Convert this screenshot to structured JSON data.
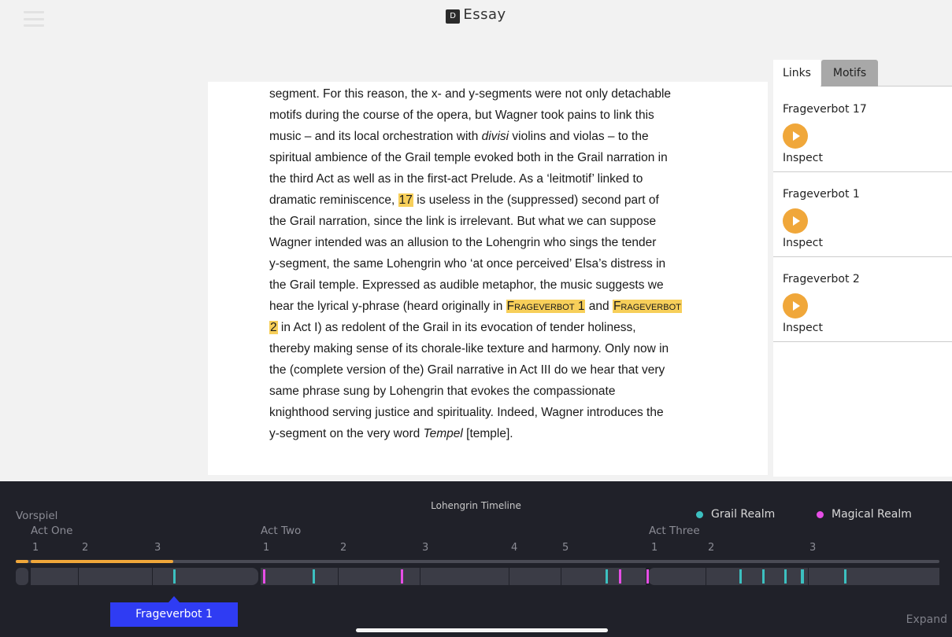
{
  "header": {
    "title": "Essay",
    "doc_icon": "document-icon"
  },
  "essay": {
    "lines": [
      [
        {
          "t": "segment. For this reason, the x- and y-segments were not only detachable"
        }
      ],
      [
        {
          "t": "motifs during the course of the opera, but Wagner took pains to link this"
        }
      ],
      [
        {
          "t": "music – and its local orchestration with "
        },
        {
          "t": "divisi",
          "s": "em"
        },
        {
          "t": " violins and violas – to the"
        }
      ],
      [
        {
          "t": "spiritual ambience of the Grail temple evoked both in the Grail narration in"
        }
      ],
      [
        {
          "t": "the third Act as well as in the first-act Prelude. As a ‘leitmotif’ linked to"
        }
      ],
      [
        {
          "t": "dramatic reminiscence, "
        },
        {
          "t": "17",
          "s": "hl"
        },
        {
          "t": " is useless in the (suppressed) second part of"
        }
      ],
      [
        {
          "t": "the Grail narration, since the link is irrelevant. But what we can suppose"
        }
      ],
      [
        {
          "t": "Wagner intended was an allusion to the Lohengrin who sings the tender"
        }
      ],
      [
        {
          "t": "y-segment, the same Lohengrin who ‘at once perceived’ Elsa’s distress in"
        }
      ],
      [
        {
          "t": "the Grail temple. Expressed as audible metaphor, the music suggests we"
        }
      ],
      [
        {
          "t": "hear the lyrical y-phrase (heard originally in "
        },
        {
          "t": "Frageverbot 1",
          "s": "hl sc"
        },
        {
          "t": " and "
        },
        {
          "t": "Frageverbot",
          "s": "hl sc"
        }
      ],
      [
        {
          "t": "2",
          "s": "hl"
        },
        {
          "t": " in Act I) as redolent of the Grail in its evocation of tender holiness,"
        }
      ],
      [
        {
          "t": "thereby making sense of its chorale-like texture and harmony. Only now in"
        }
      ],
      [
        {
          "t": "the (complete version of the) Grail narrative in Act III do we hear that very"
        }
      ],
      [
        {
          "t": "same phrase sung by Lohengrin that evokes the compassionate"
        }
      ],
      [
        {
          "t": "knighthood serving justice and spirituality. Indeed, Wagner introduces the"
        }
      ],
      [
        {
          "t": "y-segment on the very word "
        },
        {
          "t": "Tempel",
          "s": "em"
        },
        {
          "t": " [temple]."
        }
      ]
    ]
  },
  "sidebar": {
    "tabs": [
      {
        "label": "Links",
        "active": true
      },
      {
        "label": "Motifs",
        "active": false
      }
    ],
    "links": [
      {
        "title": "Frageverbot 17",
        "action": "Inspect",
        "icon": "play-icon"
      },
      {
        "title": "Frageverbot 1",
        "action": "Inspect",
        "icon": "play-icon"
      },
      {
        "title": "Frageverbot 2",
        "action": "Inspect",
        "icon": "play-icon"
      }
    ]
  },
  "timeline": {
    "title": "Lohengrin Timeline",
    "legend": [
      {
        "label": "Grail Realm",
        "color": "#3cc0c0"
      },
      {
        "label": "Magical Realm",
        "color": "#e64ee6"
      }
    ],
    "sections": {
      "prelude": "Vorspiel",
      "act1": "Act One",
      "act2": "Act Two",
      "act3": "Act Three"
    },
    "scenes": {
      "act1": [
        "1",
        "2",
        "3"
      ],
      "act2": [
        "1",
        "2",
        "3",
        "4",
        "5"
      ],
      "act3": [
        "1",
        "2",
        "3"
      ]
    },
    "tooltip": "Frageverbot 1",
    "expand_label": "Expand",
    "colors": {
      "progress": "#f0a73a",
      "grail": "#3cc0c0",
      "magical": "#e64ee6",
      "tooltip": "#2f3cf3"
    }
  }
}
